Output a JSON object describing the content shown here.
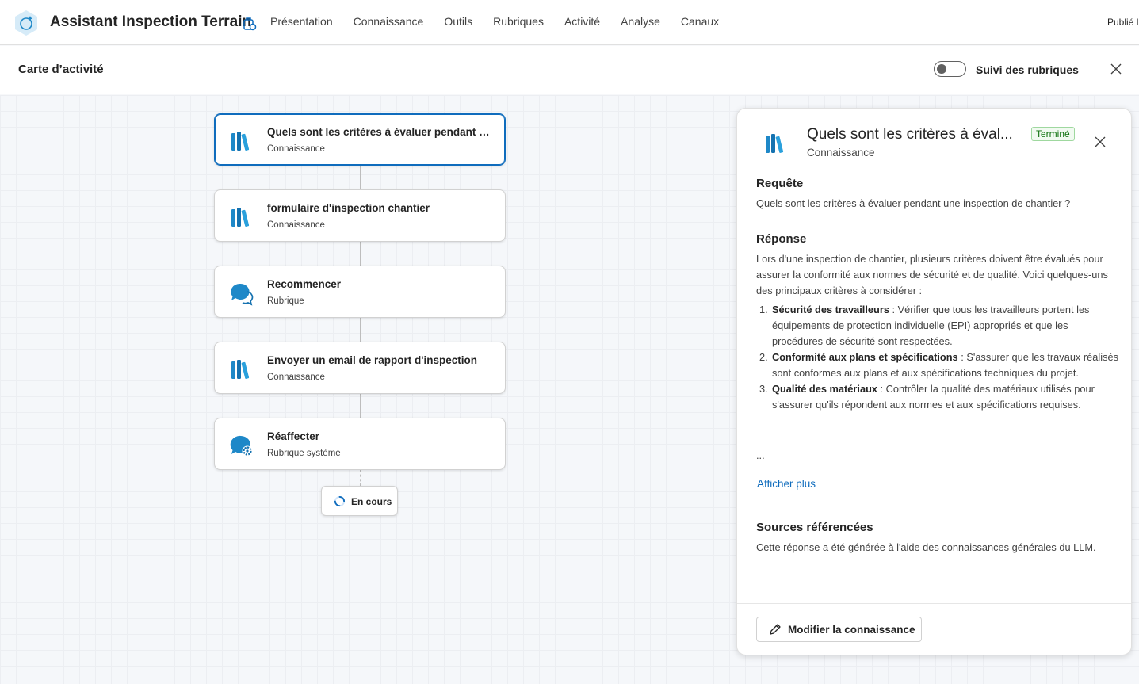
{
  "app": {
    "title": "Assistant Inspection Terrain",
    "publish_status": "Publié l",
    "nav": [
      "Présentation",
      "Connaissance",
      "Outils",
      "Rubriques",
      "Activité",
      "Analyse",
      "Canaux"
    ]
  },
  "subheader": {
    "title": "Carte d’activité",
    "toggle_label": "Suivi des rubriques",
    "toggle_on": false
  },
  "nodes": [
    {
      "title": "Quels sont les critères à évaluer pendant une inspection de chantier ?",
      "subtitle": "Connaissance",
      "icon": "books-icon",
      "selected": true
    },
    {
      "title": "formulaire d'inspection chantier",
      "subtitle": "Connaissance",
      "icon": "books-icon",
      "selected": false
    },
    {
      "title": "Recommencer",
      "subtitle": "Rubrique",
      "icon": "chat-bubbles-icon",
      "selected": false
    },
    {
      "title": "Envoyer un email de rapport d'inspection",
      "subtitle": "Connaissance",
      "icon": "books-icon",
      "selected": false
    },
    {
      "title": "Réaffecter",
      "subtitle": "Rubrique système",
      "icon": "chat-gear-icon",
      "selected": false
    }
  ],
  "status": {
    "label": "En cours"
  },
  "panel": {
    "title": "Quels sont les critères à éval...",
    "badge": "Terminé",
    "subtitle": "Connaissance",
    "query_heading": "Requête",
    "query_text": "Quels sont les critères à évaluer pendant une inspection de chantier ?",
    "response_heading": "Réponse",
    "response_intro": "Lors d'une inspection de chantier, plusieurs critères doivent être évalués pour assurer la conformité aux normes de sécurité et de qualité. Voici quelques-uns des principaux critères à considérer :",
    "response_items": [
      {
        "num": "1.",
        "bold": "Sécurité des travailleurs",
        "text": " : Vérifier que tous les travailleurs portent les équipements de protection individuelle (EPI) appropriés et que les procédures de sécurité sont respectées."
      },
      {
        "num": "2.",
        "bold": "Conformité aux plans et spécifications",
        "text": " : S'assurer que les travaux réalisés sont conformes aux plans et aux spécifications techniques du projet."
      },
      {
        "num": "3.",
        "bold": "Qualité des matériaux",
        "text": " : Contrôler la qualité des matériaux utilisés pour s'assurer qu'ils répondent aux normes et aux spécifications requises."
      }
    ],
    "ellipsis": "...",
    "show_more": "Afficher plus",
    "sources_heading": "Sources référencées",
    "sources_text": "Cette réponse a été générée à l'aide des connaissances générales du LLM.",
    "edit_button": "Modifier la connaissance"
  },
  "colors": {
    "accent": "#0f6cbd",
    "badge_green": "#0e700e",
    "icon_blue": "#1e88c8"
  }
}
